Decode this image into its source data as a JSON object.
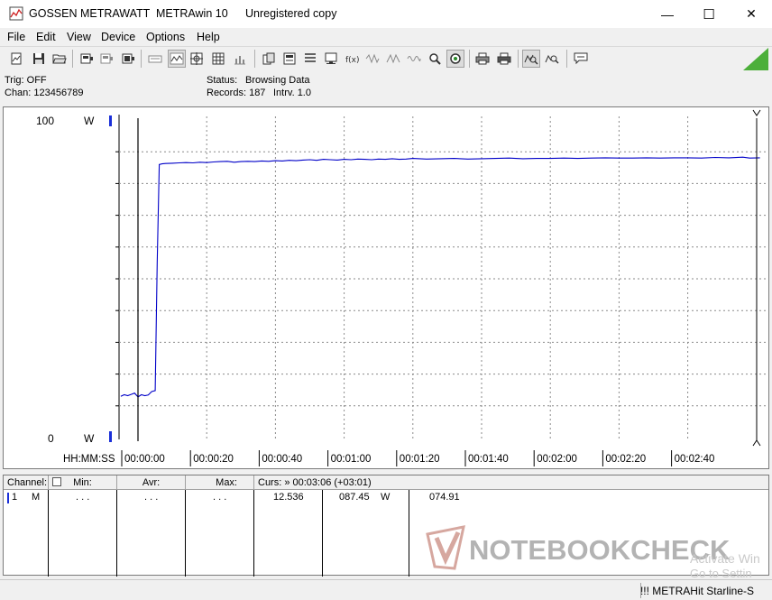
{
  "titlebar": {
    "vendor": "GOSSEN METRAWATT",
    "app": "METRAwin 10",
    "license": "Unregistered copy",
    "minimize": "—",
    "maximize": "☐",
    "close": "✕"
  },
  "menu": [
    "File",
    "Edit",
    "View",
    "Device",
    "Options",
    "Help"
  ],
  "info": {
    "trig": "Trig: OFF",
    "chan": "Chan:  123456789",
    "status_label": "Status:",
    "status_value": "Browsing Data",
    "records": "Records: 187",
    "interval": "Intrv. 1.0"
  },
  "chart_data": {
    "type": "line",
    "ylim": [
      0,
      100
    ],
    "y_top_label": "100",
    "y_bottom_label": "0",
    "y_unit": "W",
    "x_axis_label": "HH:MM:SS",
    "x_ticks": [
      "00:00:00",
      "00:00:20",
      "00:00:40",
      "00:01:00",
      "00:01:20",
      "00:01:40",
      "00:02:00",
      "00:02:20",
      "00:02:40"
    ],
    "x_tick_seconds": [
      0,
      20,
      40,
      60,
      80,
      100,
      120,
      140,
      160
    ],
    "xlim": [
      -5,
      181
    ],
    "grid": true,
    "line_color": "#0000c8",
    "series": [
      {
        "x": [
          -5,
          -4,
          -3,
          -2,
          -1,
          0,
          1,
          2,
          3,
          4,
          5,
          5.6,
          6.2,
          7,
          8,
          10,
          12,
          14,
          16,
          18,
          20,
          22,
          24,
          26,
          28,
          30,
          32,
          34,
          36,
          38,
          40,
          42,
          44,
          46,
          48,
          50,
          52,
          54,
          56,
          58,
          60,
          62,
          64,
          66,
          68,
          70,
          72,
          74,
          76,
          78,
          80,
          84,
          88,
          92,
          96,
          100,
          104,
          108,
          112,
          116,
          120,
          124,
          128,
          132,
          136,
          140,
          144,
          148,
          152,
          156,
          160,
          164,
          168,
          172,
          176,
          178,
          181
        ],
        "y": [
          13,
          13.5,
          13.2,
          13.6,
          14,
          12.8,
          13.5,
          13.2,
          13.4,
          14.5,
          14.8,
          55,
          86,
          86.2,
          86.3,
          86.4,
          86.5,
          86.6,
          86.5,
          86.7,
          86.6,
          86.8,
          86.9,
          87,
          86.7,
          86.9,
          87,
          86.9,
          87.1,
          87,
          87.2,
          87.1,
          87.3,
          87.2,
          87.4,
          87.5,
          87.3,
          87.6,
          87.5,
          87.4,
          87.6,
          87.5,
          87.7,
          87.6,
          87.5,
          87.7,
          87.6,
          87.8,
          87.6,
          87.7,
          87.9,
          87.7,
          87.8,
          87.9,
          87.7,
          87.8,
          87.9,
          88,
          87.8,
          87.9,
          87.9,
          88,
          87.9,
          88,
          88.1,
          88,
          88,
          88.1,
          88,
          88.1,
          88.1,
          88,
          88.2,
          88.1,
          88.3,
          88,
          88.1
        ]
      }
    ]
  },
  "table": {
    "headers": {
      "channel": "Channel:",
      "min": "Min:",
      "avr": "Avr:",
      "max": "Max:",
      "cursor": "Curs: » 00:03:06 (+03:01)"
    },
    "row": {
      "num": "1",
      "mode": "M",
      "min": ". . .",
      "avr": ". . .",
      "max": ". . .",
      "c1": "12.536",
      "c2": "087.45",
      "c2_unit": "W",
      "c3": "074.91"
    }
  },
  "statusbar": {
    "device": "!!! METRAHit Starline-S"
  },
  "watermark": {
    "text": "NOTEBOOKCHECK",
    "activate": "Activate Win",
    "settings": "Go to Settin"
  },
  "colors": {
    "accent_green": "#4caf3a",
    "line_blue": "#0000c8",
    "marker_blue": "#1a2fd8"
  }
}
